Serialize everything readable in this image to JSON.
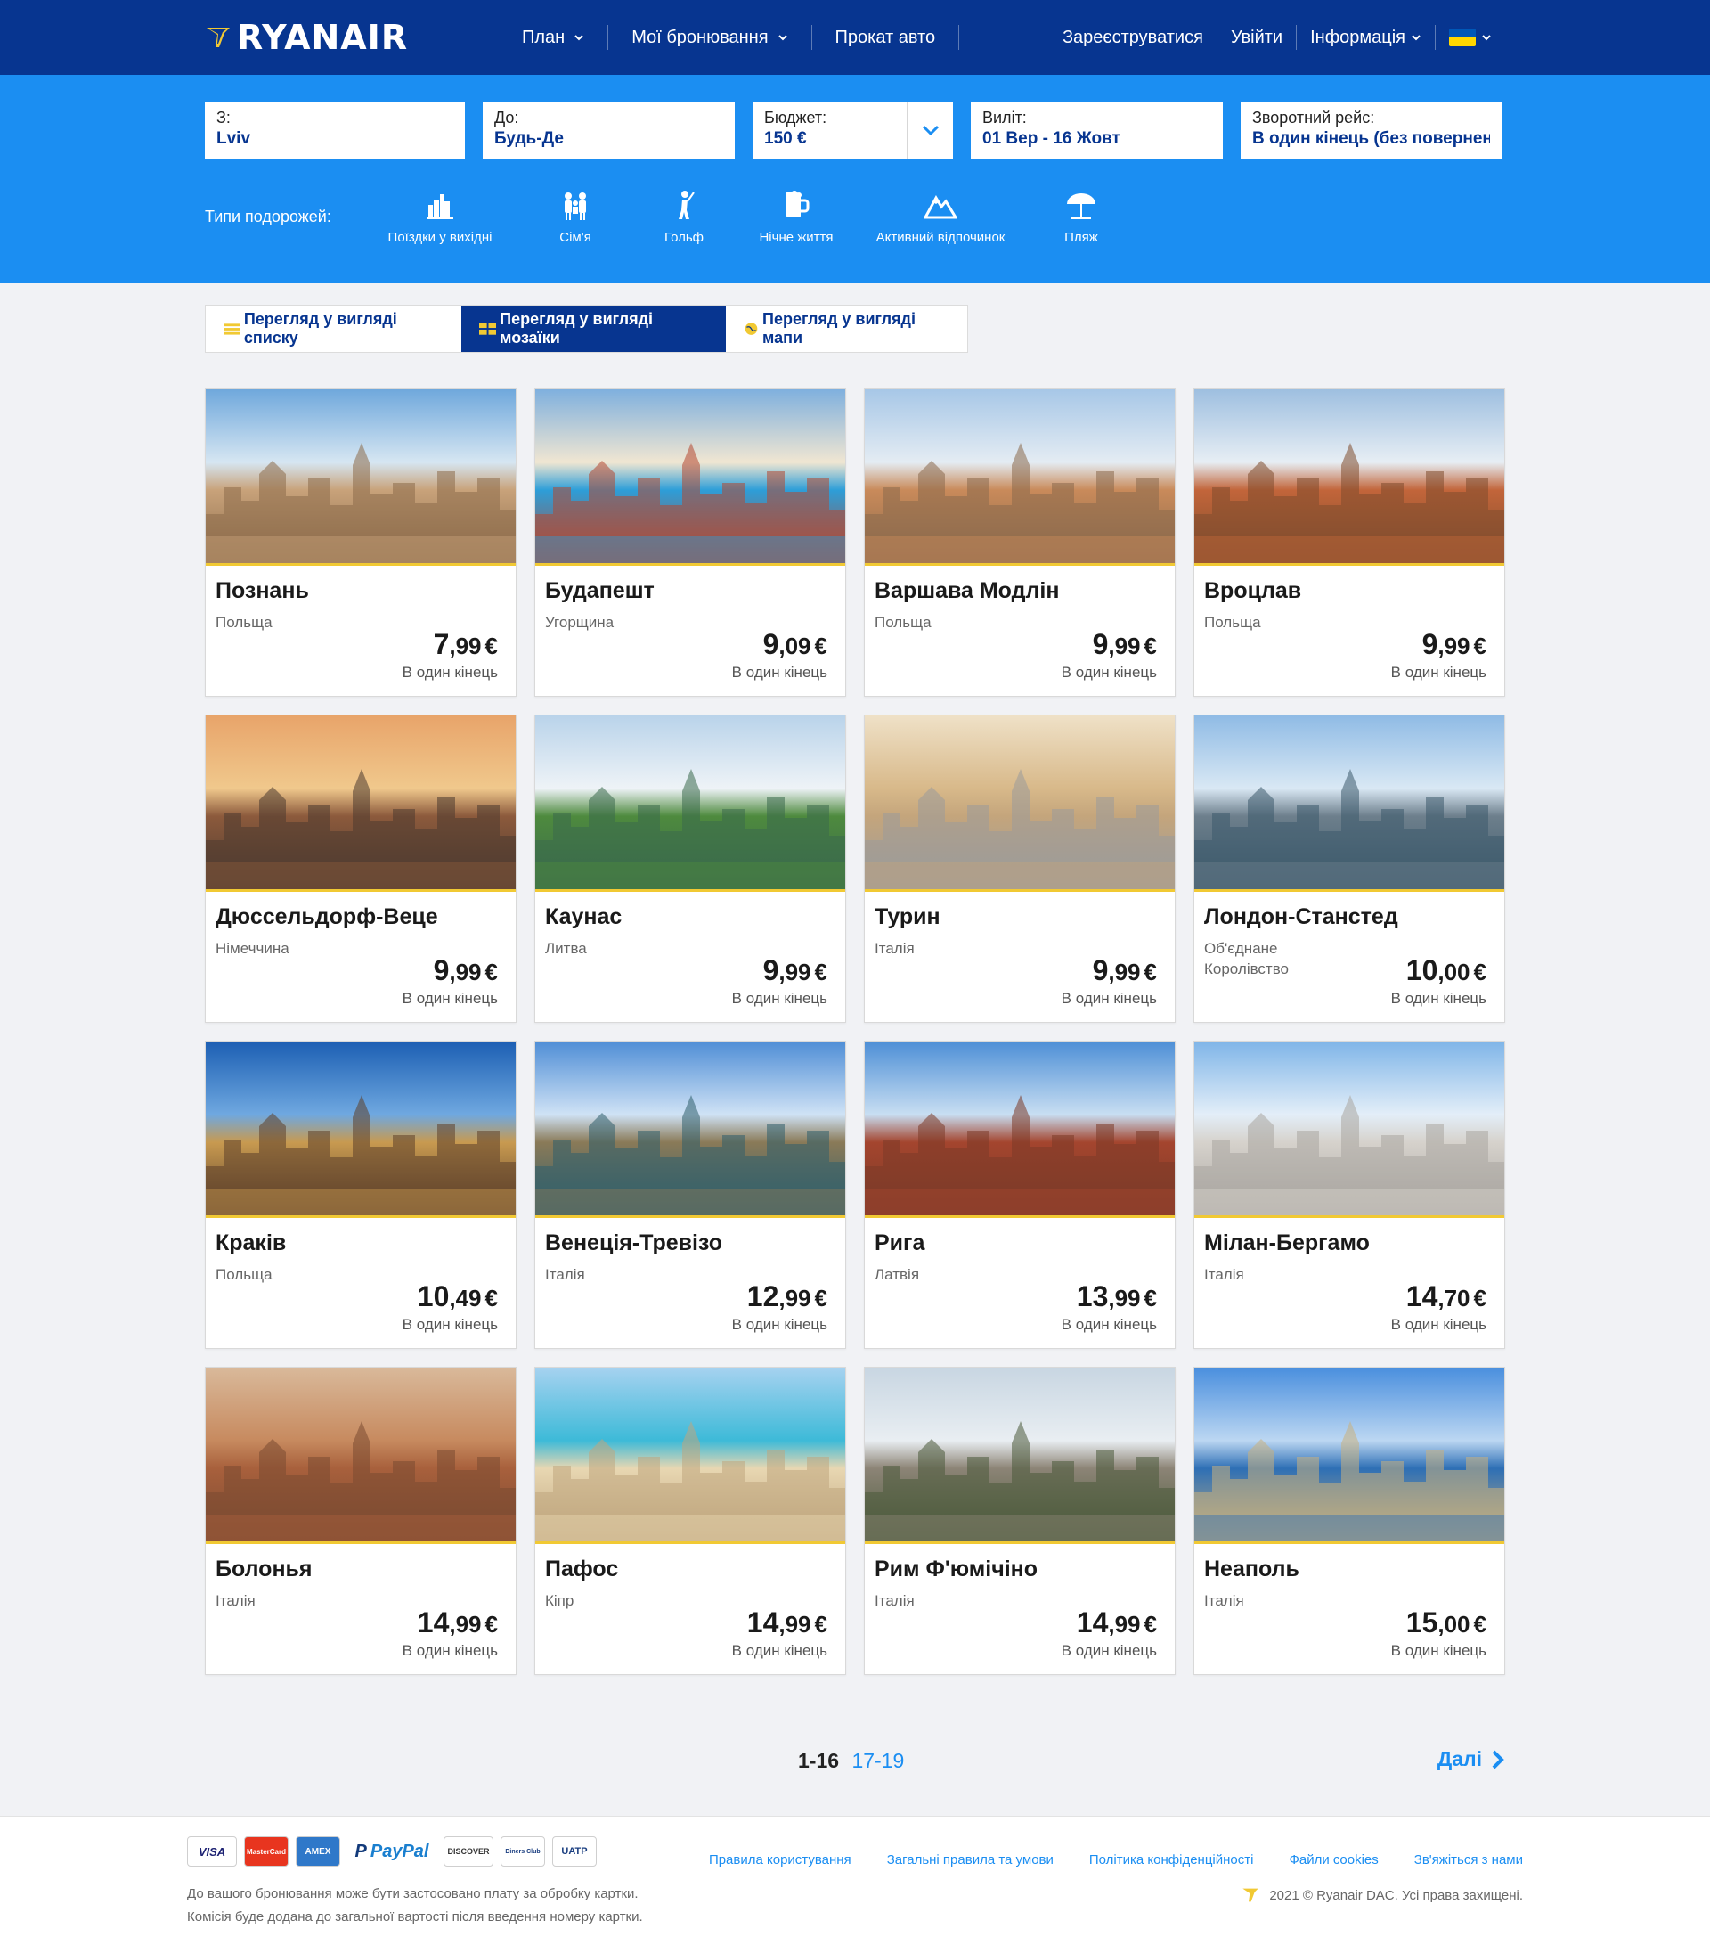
{
  "header": {
    "brand": "RYANAIR",
    "nav": [
      {
        "label": "План",
        "dropdown": true
      },
      {
        "label": "Мої бронювання",
        "dropdown": true
      },
      {
        "label": "Прокат авто",
        "dropdown": false
      }
    ],
    "register": "Зареєструватися",
    "login": "Увійти",
    "info": "Інформація"
  },
  "search": {
    "from_label": "З:",
    "from_value": "Lviv",
    "to_label": "До:",
    "to_value": "Будь-Де",
    "budget_label": "Бюджет:",
    "budget_value": "150 €",
    "depart_label": "Виліт:",
    "depart_value": "01 Вер - 16 Жовт",
    "return_label": "Зворотний рейс:",
    "return_value": "В один кінець (без повернення)"
  },
  "trip_types": {
    "label": "Типи подорожей:",
    "items": [
      {
        "label": "Поїздки у вихідні",
        "icon": "city-icon"
      },
      {
        "label": "Сім'я",
        "icon": "family-icon"
      },
      {
        "label": "Гольф",
        "icon": "golf-icon"
      },
      {
        "label": "Нічне життя",
        "icon": "beer-icon"
      },
      {
        "label": "Активний відпочинок",
        "icon": "mountain-icon"
      },
      {
        "label": "Пляж",
        "icon": "umbrella-icon"
      }
    ]
  },
  "views": {
    "list": "Перегляд у вигляді списку",
    "mosaic": "Перегляд у вигляді мозаїки",
    "map": "Перегляд у вигляді мапи"
  },
  "one_way": "В один кінець",
  "destinations": [
    {
      "city": "Познань",
      "country": "Польща",
      "int": "7",
      "dec": ",99",
      "cur": "€"
    },
    {
      "city": "Будапешт",
      "country": "Угорщина",
      "int": "9",
      "dec": ",09",
      "cur": "€"
    },
    {
      "city": "Варшава Модлін",
      "country": "Польща",
      "int": "9",
      "dec": ",99",
      "cur": "€"
    },
    {
      "city": "Вроцлав",
      "country": "Польща",
      "int": "9",
      "dec": ",99",
      "cur": "€"
    },
    {
      "city": "Дюссельдорф-Веце",
      "country": "Німеччина",
      "int": "9",
      "dec": ",99",
      "cur": "€"
    },
    {
      "city": "Каунас",
      "country": "Литва",
      "int": "9",
      "dec": ",99",
      "cur": "€"
    },
    {
      "city": "Турин",
      "country": "Італія",
      "int": "9",
      "dec": ",99",
      "cur": "€"
    },
    {
      "city": "Лондон-Станстед",
      "country": "Об'єднане Королівство",
      "int": "10",
      "dec": ",00",
      "cur": "€"
    },
    {
      "city": "Краків",
      "country": "Польща",
      "int": "10",
      "dec": ",49",
      "cur": "€"
    },
    {
      "city": "Венеція-Тревізо",
      "country": "Італія",
      "int": "12",
      "dec": ",99",
      "cur": "€"
    },
    {
      "city": "Рига",
      "country": "Латвія",
      "int": "13",
      "dec": ",99",
      "cur": "€"
    },
    {
      "city": "Мілан-Бергамо",
      "country": "Італія",
      "int": "14",
      "dec": ",70",
      "cur": "€"
    },
    {
      "city": "Болонья",
      "country": "Італія",
      "int": "14",
      "dec": ",99",
      "cur": "€"
    },
    {
      "city": "Пафос",
      "country": "Кіпр",
      "int": "14",
      "dec": ",99",
      "cur": "€"
    },
    {
      "city": "Рим Ф'юмічіно",
      "country": "Італія",
      "int": "14",
      "dec": ",99",
      "cur": "€"
    },
    {
      "city": "Неаполь",
      "country": "Італія",
      "int": "15",
      "dec": ",00",
      "cur": "€"
    }
  ],
  "pagination": {
    "current": "1-16",
    "next_range": "17-19",
    "next_label": "Далі"
  },
  "footer": {
    "payment_cards": [
      "VISA",
      "MasterCard",
      "AMEX",
      "PayPal",
      "DISCOVER",
      "Diners Club",
      "UATP"
    ],
    "note_line1": "До вашого бронювання може бути застосовано плату за обробку картки.",
    "note_line2": "Комісія буде додана до загальної вартості після введення номеру картки.",
    "links": [
      "Правила користування",
      "Загальні правила та умови",
      "Політика конфіденційності",
      "Файли cookies",
      "Зв'яжіться з нами"
    ],
    "copyright": "2021 © Ryanair DAC. Усі права захищені."
  },
  "colors": {
    "header": "#073590",
    "band": "#1b8ef2",
    "accent": "#f1c933"
  }
}
